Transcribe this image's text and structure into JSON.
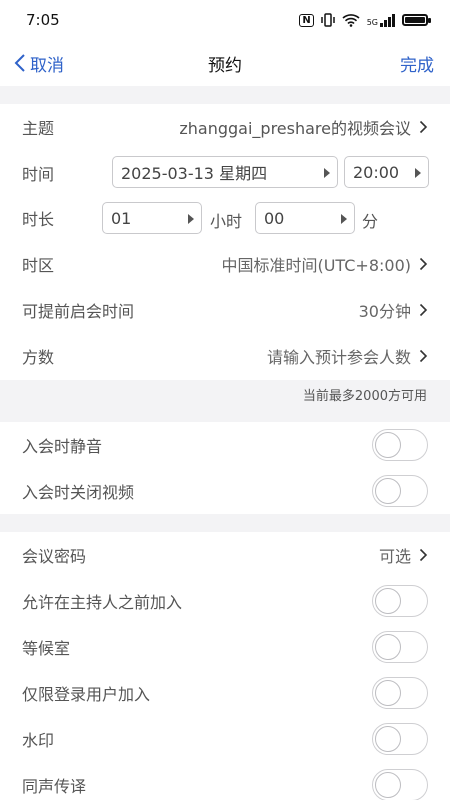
{
  "status": {
    "time": "7:05",
    "nfc": "N",
    "signal_text": "5G"
  },
  "nav": {
    "cancel": "取消",
    "title": "预约",
    "done": "完成"
  },
  "topic": {
    "label": "主题",
    "value": "zhanggai_preshare的视频会议"
  },
  "time": {
    "label": "时间",
    "date": "2025-03-13 星期四",
    "clock": "20:00"
  },
  "duration": {
    "label": "时长",
    "hours": "01",
    "hour_unit": "小时",
    "minutes": "00",
    "minute_unit": "分"
  },
  "timezone": {
    "label": "时区",
    "value": "中国标准时间(UTC+8:00)"
  },
  "early_start": {
    "label": "可提前启会时间",
    "value": "30分钟"
  },
  "participants": {
    "label": "方数",
    "placeholder": "请输入预计参会人数"
  },
  "capacity_note": "当前最多2000方可用",
  "toggles1": [
    {
      "label": "入会时静音",
      "on": false
    },
    {
      "label": "入会时关闭视频",
      "on": false
    }
  ],
  "password": {
    "label": "会议密码",
    "value": "可选"
  },
  "toggles2": [
    {
      "label": "允许在主持人之前加入",
      "on": false
    },
    {
      "label": "等候室",
      "on": false
    },
    {
      "label": "仅限登录用户加入",
      "on": false
    },
    {
      "label": "水印",
      "on": false
    },
    {
      "label": "同声传译",
      "on": false
    }
  ],
  "colors": {
    "accent": "#2f62c9",
    "divider_bg": "#f3f3f5"
  }
}
